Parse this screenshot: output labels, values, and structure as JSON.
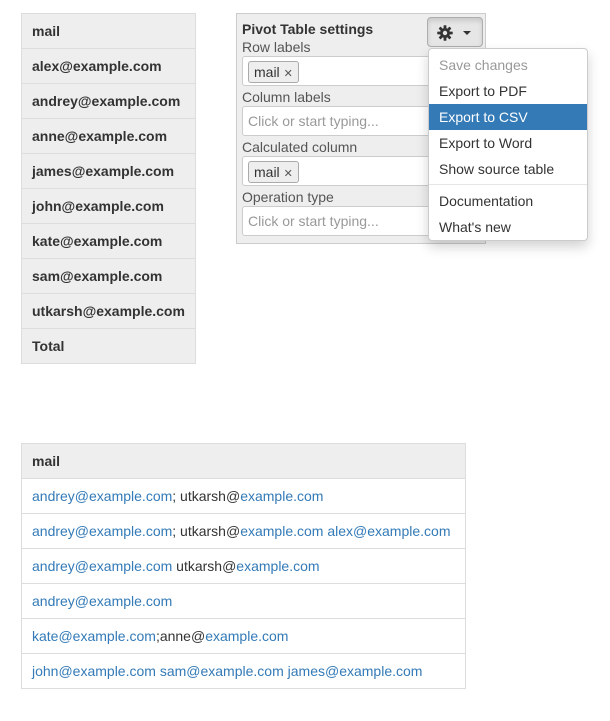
{
  "pivot": {
    "header": "mail",
    "rows": [
      "alex@example.com",
      "andrey@example.com",
      "anne@example.com",
      "james@example.com",
      "john@example.com",
      "kate@example.com",
      "sam@example.com",
      "utkarsh@example.com"
    ],
    "total_label": "Total"
  },
  "settings": {
    "title": "Pivot Table settings",
    "row_labels": {
      "label": "Row labels",
      "chip": "mail"
    },
    "column_labels": {
      "label": "Column labels",
      "placeholder": "Click or start typing..."
    },
    "calculated_column": {
      "label": "Calculated column",
      "chip": "mail"
    },
    "operation_type": {
      "label": "Operation type",
      "placeholder": "Click or start typing..."
    },
    "gear_icon": "gear-icon"
  },
  "menu": {
    "items": [
      {
        "label": "Save changes",
        "state": "disabled"
      },
      {
        "label": "Export to PDF",
        "state": "normal"
      },
      {
        "label": "Export to CSV",
        "state": "active"
      },
      {
        "label": "Export to Word",
        "state": "normal"
      },
      {
        "label": "Show source table",
        "state": "normal"
      }
    ],
    "extra_items": [
      {
        "label": "Documentation"
      },
      {
        "label": "What's new"
      }
    ]
  },
  "mail_table": {
    "header": "mail",
    "rows": [
      [
        {
          "t": "andrey@example.com",
          "link": true
        },
        {
          "t": "; utkarsh@",
          "link": false
        },
        {
          "t": "example.com",
          "link": true
        }
      ],
      [
        {
          "t": "andrey@example.com",
          "link": true
        },
        {
          "t": "; utkarsh@",
          "link": false
        },
        {
          "t": "example.com",
          "link": true
        },
        {
          "t": " ",
          "link": false
        },
        {
          "t": "alex@example.com",
          "link": true
        }
      ],
      [
        {
          "t": "andrey@example.com",
          "link": true
        },
        {
          "t": " utkarsh@",
          "link": false
        },
        {
          "t": "example.com",
          "link": true
        }
      ],
      [
        {
          "t": "andrey@example.com",
          "link": true
        }
      ],
      [
        {
          "t": "kate@example.com",
          "link": true
        },
        {
          "t": ";anne@",
          "link": false
        },
        {
          "t": "example.com",
          "link": true
        }
      ],
      [
        {
          "t": "john@example.com",
          "link": true
        },
        {
          "t": " ",
          "link": false
        },
        {
          "t": "sam@example.com",
          "link": true
        },
        {
          "t": " ",
          "link": false
        },
        {
          "t": "james@example.com",
          "link": true
        }
      ]
    ]
  },
  "colors": {
    "link": "#337ab7",
    "active_bg": "#337ab7",
    "header_bg": "#eeeeee"
  }
}
